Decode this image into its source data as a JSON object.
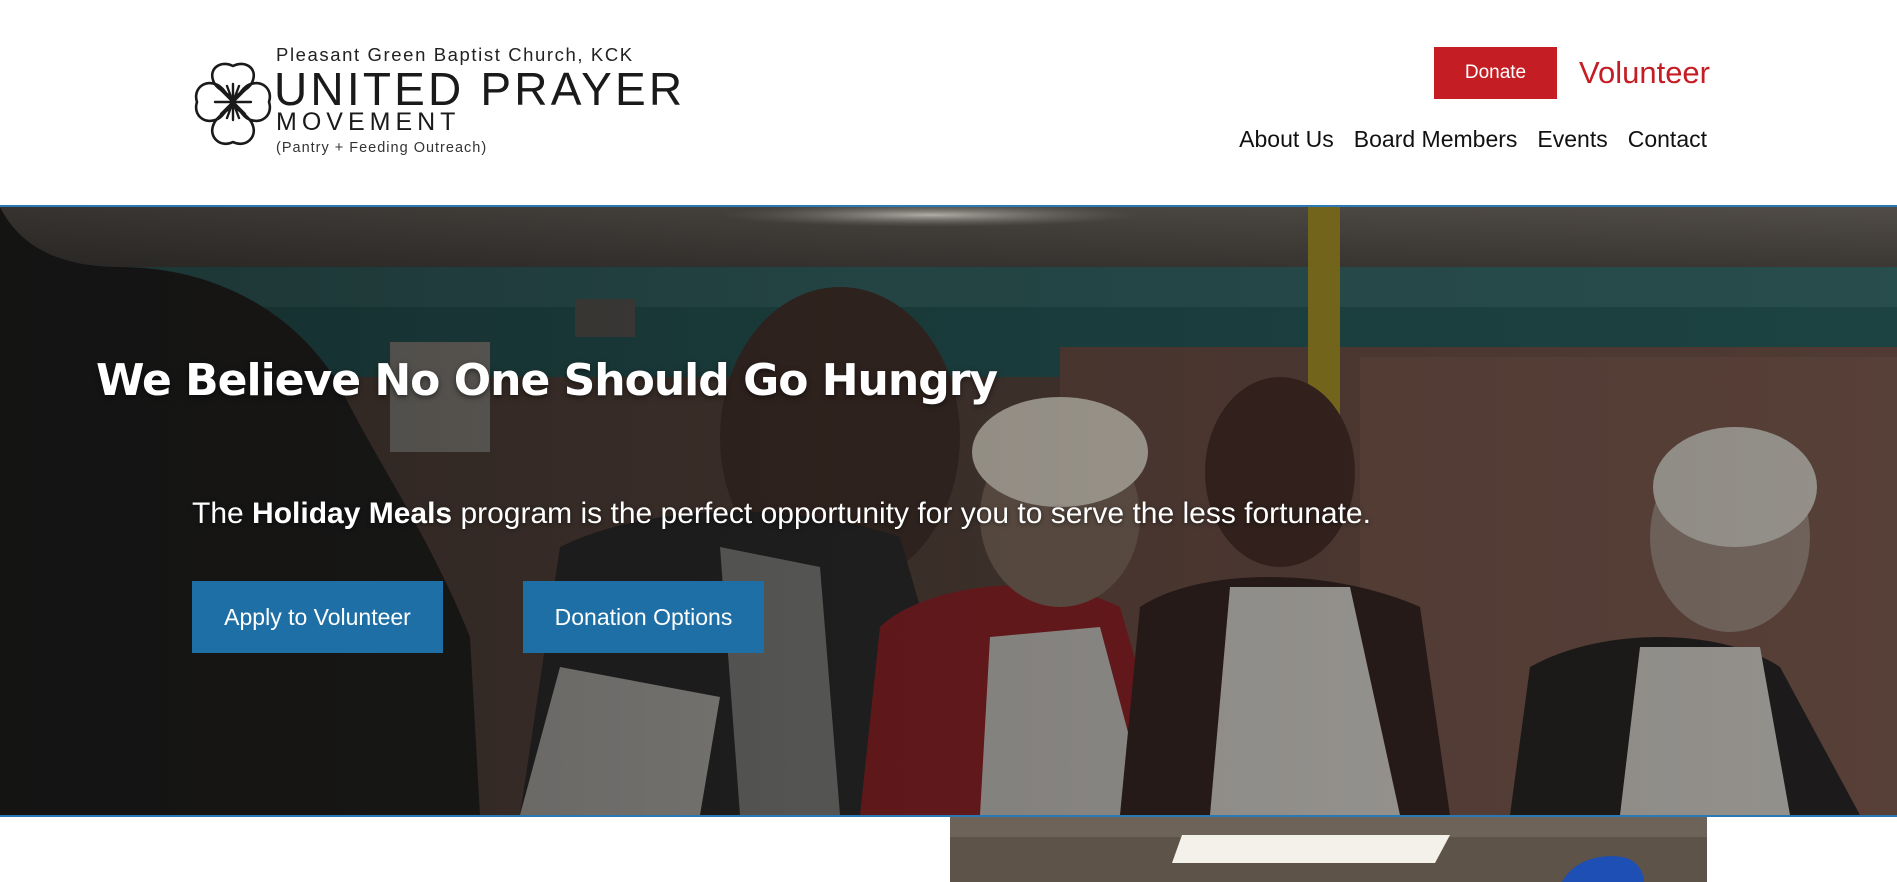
{
  "header": {
    "logo": {
      "church": "Pleasant Green Baptist Church, KCK",
      "title": "UNITED PRAYER",
      "subtitle": "MOVEMENT",
      "tagline": "(Pantry + Feeding Outreach)"
    },
    "donate_label": "Donate",
    "volunteer_label": "Volunteer",
    "nav": [
      "About Us",
      "Board Members",
      "Events",
      "Contact"
    ]
  },
  "hero": {
    "heading": "We Believe No One Should Go Hungry",
    "text_prefix": "The ",
    "text_bold": "Holiday Meals",
    "text_suffix": " program is the perfect opportunity for you to serve the less fortunate.",
    "apply_label": "Apply to Volunteer",
    "donation_label": "Donation Options",
    "photo_icon": "volunteers-serving-photo"
  },
  "colors": {
    "brand_red": "#c41e24",
    "brand_blue": "#1f6fa7",
    "rule_blue": "#2a78b4"
  }
}
